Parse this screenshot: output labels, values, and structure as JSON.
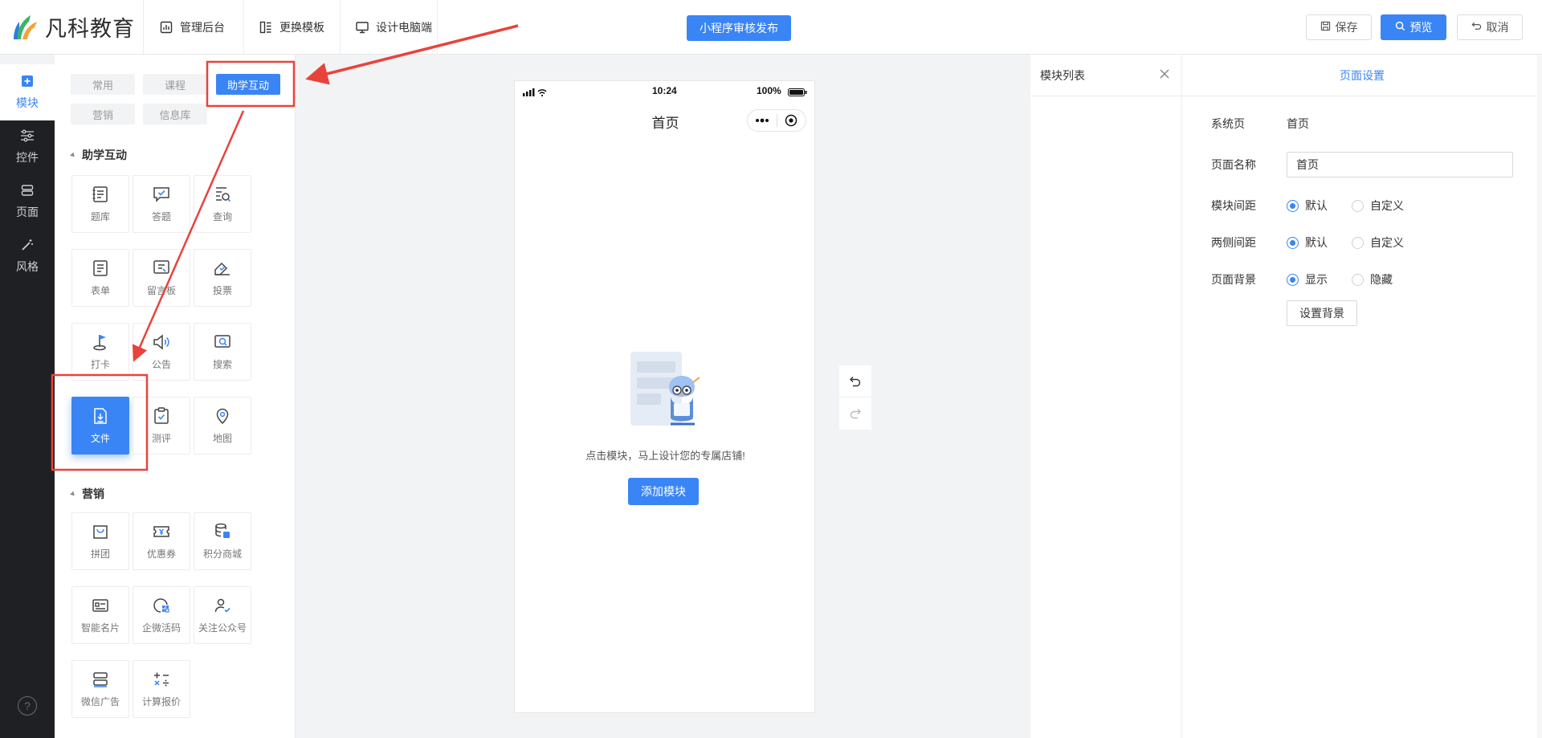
{
  "brand": {
    "name": "凡科教育"
  },
  "top_nav": [
    {
      "label": "管理后台",
      "icon": "chart-icon"
    },
    {
      "label": "更换模板",
      "icon": "template-icon"
    },
    {
      "label": "设计电脑端",
      "icon": "monitor-icon"
    }
  ],
  "publish_label": "小程序审核发布",
  "actions": {
    "save": "保存",
    "preview": "预览",
    "cancel": "取消"
  },
  "dark_sidebar": [
    {
      "label": "模块",
      "icon": "plus-square-icon",
      "active": true
    },
    {
      "label": "控件",
      "icon": "sliders-icon",
      "active": false
    },
    {
      "label": "页面",
      "icon": "pages-icon",
      "active": false
    },
    {
      "label": "风格",
      "icon": "magic-wand-icon",
      "active": false
    }
  ],
  "help_label": "?",
  "category_tabs": [
    {
      "label": "常用",
      "active": false
    },
    {
      "label": "课程",
      "active": false
    },
    {
      "label": "助学互动",
      "active": true
    },
    {
      "label": "营销",
      "active": false
    },
    {
      "label": "信息库",
      "active": false
    }
  ],
  "sections": [
    {
      "title": "助学互动",
      "items": [
        {
          "label": "题库",
          "icon": "question-bank-icon"
        },
        {
          "label": "答题",
          "icon": "answer-icon"
        },
        {
          "label": "查询",
          "icon": "query-icon"
        },
        {
          "label": "表单",
          "icon": "form-icon"
        },
        {
          "label": "留言板",
          "icon": "message-board-icon"
        },
        {
          "label": "投票",
          "icon": "vote-icon"
        },
        {
          "label": "打卡",
          "icon": "checkin-flag-icon"
        },
        {
          "label": "公告",
          "icon": "speaker-icon"
        },
        {
          "label": "搜索",
          "icon": "search-icon"
        },
        {
          "label": "文件",
          "icon": "file-download-icon",
          "selected": true
        },
        {
          "label": "测评",
          "icon": "clipboard-check-icon"
        },
        {
          "label": "地图",
          "icon": "map-pin-icon"
        }
      ]
    },
    {
      "title": "营销",
      "items": [
        {
          "label": "拼团",
          "icon": "group-buy-icon"
        },
        {
          "label": "优惠券",
          "icon": "coupon-icon"
        },
        {
          "label": "积分商城",
          "icon": "points-mall-icon"
        },
        {
          "label": "智能名片",
          "icon": "business-card-icon"
        },
        {
          "label": "企微活码",
          "icon": "wecom-code-icon"
        },
        {
          "label": "关注公众号",
          "icon": "follow-account-icon"
        },
        {
          "label": "微信广告",
          "icon": "wechat-ad-icon"
        },
        {
          "label": "计算报价",
          "icon": "calculator-icon"
        }
      ]
    }
  ],
  "phone": {
    "time": "10:24",
    "battery": "100%",
    "title": "首页",
    "empty_text": "点击模块，马上设计您的专属店铺!",
    "add_button": "添加模块"
  },
  "module_list": {
    "title": "模块列表"
  },
  "settings": {
    "tab": "页面设置",
    "system_page_label": "系统页",
    "system_page_value": "首页",
    "page_name_label": "页面名称",
    "page_name_value": "首页",
    "module_spacing_label": "模块间距",
    "side_spacing_label": "两侧间距",
    "page_bg_label": "页面背景",
    "opt_default": "默认",
    "opt_custom": "自定义",
    "opt_show": "显示",
    "opt_hide": "隐藏",
    "set_bg_button": "设置背景"
  },
  "colors": {
    "primary": "#3a85f5",
    "sidebar_dark": "#1f2024",
    "annotation_red": "#e8433b"
  }
}
